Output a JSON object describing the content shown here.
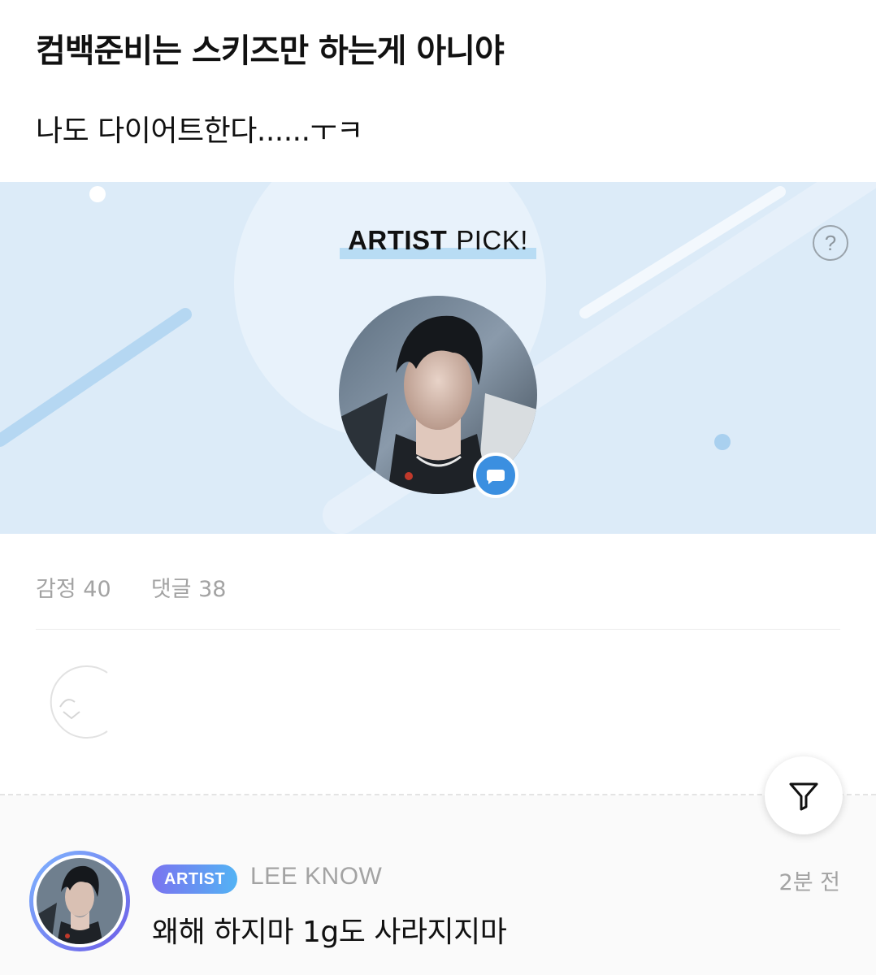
{
  "post": {
    "title": "컴백준비는 스키즈만 하는게 아니야",
    "body": "나도 다이어트한다......ㅜㅋ"
  },
  "artist_pick": {
    "title_strong": "ARTIST",
    "title_light": "PICK!",
    "help_icon": "question-circle-icon",
    "badge_icon": "chat-bubble-icon",
    "colors": {
      "banner_bg": "#dcebf8",
      "highlight": "#b8dcf4",
      "badge": "#3b8fe0"
    }
  },
  "stats": {
    "emotion_label": "감정",
    "emotion_count": "40",
    "comment_label": "댓글",
    "comment_count": "38"
  },
  "filter_button": {
    "icon": "filter-funnel-icon"
  },
  "comment": {
    "badge": "ARTIST",
    "author": "LEE KNOW",
    "time": "2분 전",
    "text": "왜해 하지마 1g도 사라지지마",
    "badge_gradient": [
      "#7a73f0",
      "#53b3f4"
    ]
  }
}
